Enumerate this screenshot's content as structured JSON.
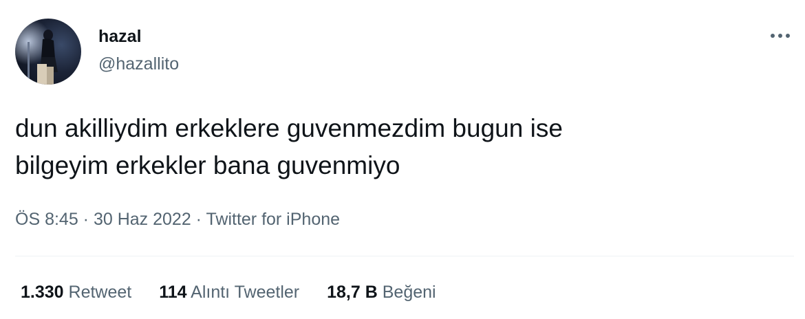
{
  "author": {
    "name": "hazal",
    "handle": "@hazallito"
  },
  "more_icon": "more-horizontal-icon",
  "tweet": {
    "text": "dun akilliydim erkeklere guvenmezdim bugun ise\nbilgeyim erkekler bana guvenmiyo"
  },
  "meta": {
    "time": "ÖS 8:45",
    "separator": " · ",
    "date": "30 Haz 2022",
    "source": "Twitter for iPhone"
  },
  "stats": {
    "retweets": {
      "count": "1.330",
      "label": "Retweet"
    },
    "quotes": {
      "count": "114",
      "label": "Alıntı Tweetler"
    },
    "likes": {
      "count": "18,7 B",
      "label": "Beğeni"
    }
  },
  "colors": {
    "primary_text": "#0f1419",
    "secondary_text": "#536471",
    "divider": "#eff3f4"
  }
}
